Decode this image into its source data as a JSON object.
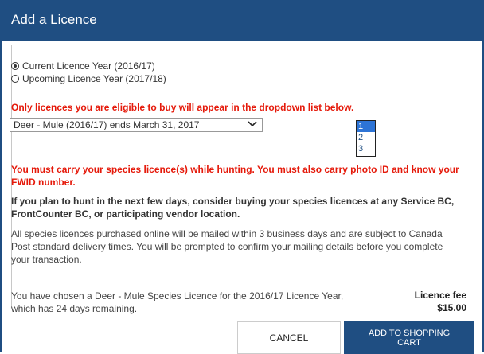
{
  "dialog": {
    "title": "Add a Licence",
    "year_options": [
      {
        "label": "Current Licence Year (2016/17)",
        "checked": true
      },
      {
        "label": "Upcoming Licence Year (2017/18)",
        "checked": false
      }
    ],
    "eligibility_note": "Only licences you are eligible to buy will appear in the dropdown list below.",
    "licence_select": {
      "selected": "Deer - Mule (2016/17) ends March 31, 2017"
    },
    "quantity_options": [
      {
        "label": "1",
        "selected": true
      },
      {
        "label": "2",
        "selected": false
      },
      {
        "label": "3",
        "selected": false
      }
    ],
    "carry_warning_line1": "You must carry your species licence(s) while hunting. You must also carry photo ID and know your",
    "carry_warning_line2": "FWID number.",
    "hunt_soon_line1": "If you plan to hunt in the next few days, consider buying your species licences at any Service BC,",
    "hunt_soon_line2": "FrontCounter BC, or participating vendor location.",
    "mailing_line1": "All species licences purchased online will be mailed within 3 business days and are subject to Canada",
    "mailing_line2": "Post standard delivery times. You will be prompted to confirm your mailing details before you complete",
    "mailing_line3": "your transaction.",
    "chosen_line1": "You have chosen a Deer - Mule Species Licence for the 2016/17 Licence Year,",
    "chosen_line2": "which has 24 days remaining.",
    "fee_label": "Licence fee",
    "fee_value": "$15.00",
    "cancel_label": "CANCEL",
    "add_label_line1": "ADD TO SHOPPING",
    "add_label_line2": "CART"
  },
  "colors": {
    "header": "#1f4e82",
    "warning": "#e5190a",
    "selected_option": "#2d74d6"
  }
}
